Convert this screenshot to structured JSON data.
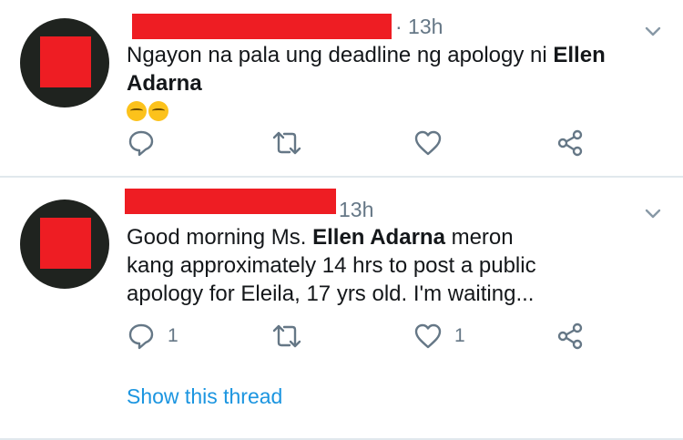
{
  "tweets": [
    {
      "time": "· 13h",
      "text_before": "Ngayon na pala ung deadline ng apology ni ",
      "mention": "Ellen Adarna",
      "text_after": "",
      "emoji": [
        "thinking-face-emoji",
        "thinking-face-emoji"
      ],
      "reply_count": "",
      "retweet_count": "",
      "like_count": ""
    },
    {
      "time": "13h",
      "text_before": "Good morning Ms. ",
      "mention": "Ellen Adarna",
      "text_after": " meron kang approximately 14 hrs to post a public apology for Eleila, 17 yrs old. I'm waiting...",
      "reply_count": "1",
      "retweet_count": "",
      "like_count": "1",
      "show_thread": "Show this thread"
    }
  ],
  "colors": {
    "redaction": "#ee1d23",
    "link": "#1b95e0",
    "icon": "#657786",
    "divider": "#e1e8ed"
  },
  "icons": [
    "chevron-down-icon",
    "reply-icon",
    "retweet-icon",
    "like-icon",
    "share-icon"
  ]
}
